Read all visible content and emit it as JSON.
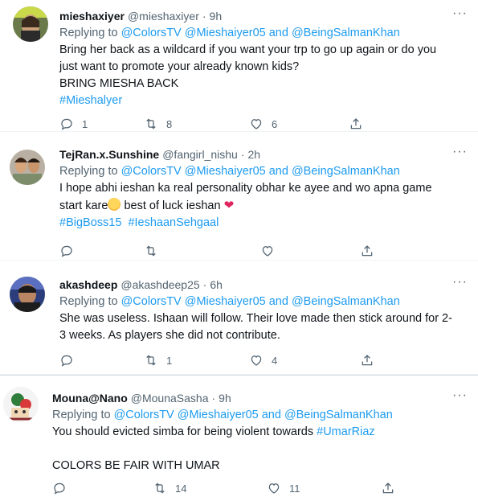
{
  "tweets": [
    {
      "name": "mieshaxiyer",
      "handle": "@mieshaxiyer",
      "time": "9h",
      "replying_prefix": "Replying to ",
      "replying_mentions": "@ColorsTV @Mieshaiyer05 and @BeingSalmanKhan",
      "text_lines": [
        "Bring her back as a wildcard if you want your trp to go up again or do you",
        "just want to promote your already known kids?",
        "BRING MIESHA BACK"
      ],
      "hashtag": "#Mieshalyer",
      "replies": "1",
      "retweets": "8",
      "likes": "6"
    },
    {
      "name": "TejRan.x.Sunshine",
      "handle": "@fangirl_nishu",
      "time": "2h",
      "replying_prefix": "Replying to ",
      "replying_mentions": "@ColorsTV @Mieshaiyer05 and @BeingSalmanKhan",
      "text_line1": "I hope abhi ieshan ka real personality obhar ke ayee and wo apna game",
      "text_line2": "start kare",
      "text_line2_after": " best of luck ieshan ",
      "hashtags": "#BigBoss15  #IeshaanSehgaal",
      "replies": "",
      "retweets": "",
      "likes": ""
    },
    {
      "name": "akashdeep",
      "handle": "@akashdeep25",
      "time": "6h",
      "replying_prefix": "Replying to ",
      "replying_mentions": "@ColorsTV @Mieshaiyer05 and @BeingSalmanKhan",
      "text_lines": [
        "She was useless. Ishaan will follow. Their love made then stick around for 2-",
        "3 weeks. As players she did not contribute."
      ],
      "replies": "",
      "retweets": "1",
      "likes": "4"
    },
    {
      "name": "Mouna@Nano",
      "handle": "@MounaSasha",
      "time": "9h",
      "replying_prefix": "Replying to ",
      "replying_mentions": "@ColorsTV @Mieshaiyer05 and @BeingSalmanKhan",
      "text_line1": "You should evicted simba for being violent towards ",
      "text_line1_tag": "#UmarRiaz",
      "text_line3": "COLORS BE FAIR WITH UMAR",
      "replies": "",
      "retweets": "14",
      "likes": "11"
    }
  ],
  "more_glyph": "···",
  "dot": "·",
  "icons": [
    "reply-icon",
    "retweet-icon",
    "like-icon",
    "share-icon",
    "more-icon"
  ],
  "colors": {
    "link": "#1d9bf0",
    "muted": "#536471",
    "text": "#0f1419",
    "heart": "#e0245e"
  }
}
